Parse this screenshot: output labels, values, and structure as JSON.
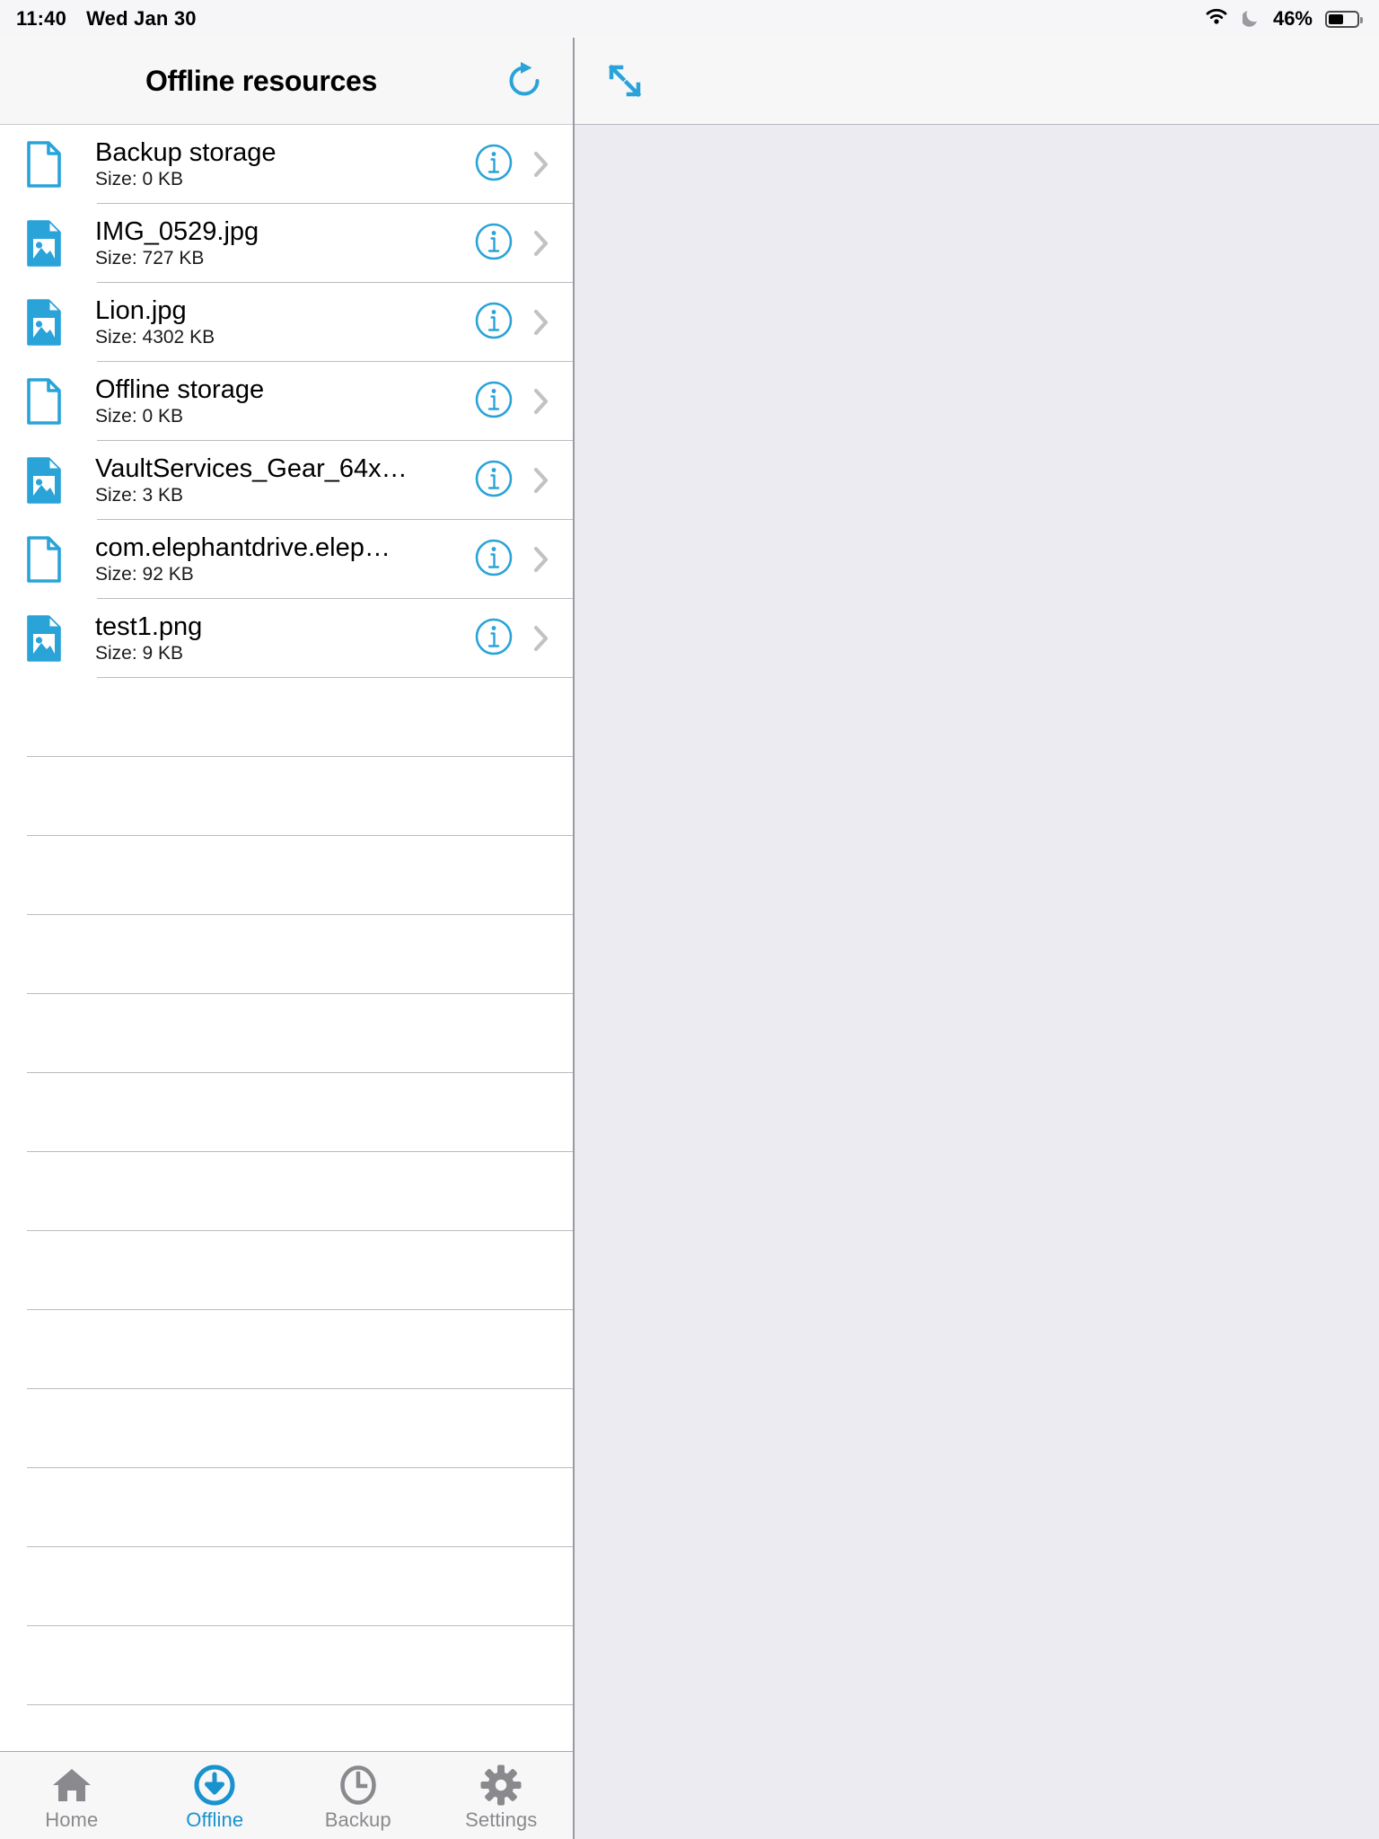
{
  "statusbar": {
    "time": "11:40",
    "date": "Wed Jan 30",
    "battery_percent": "46%",
    "icons": [
      "wifi-icon",
      "moon-icon",
      "battery-icon"
    ]
  },
  "navbar": {
    "title": "Offline resources",
    "refresh_icon": "refresh-icon",
    "expand_icon": "expand-diagonal-icon"
  },
  "colors": {
    "accent": "#1893CE",
    "icon_blue": "#29A3D8",
    "separator": "#BCBCC0",
    "detail_pane_bg": "#ECEBF1",
    "bar_bg": "#F7F7F8",
    "tab_inactive": "#8A8A8E"
  },
  "list": {
    "info_icon": "info-circle-icon",
    "chevron_icon": "chevron-right-icon",
    "empty_row_count": 13,
    "items": [
      {
        "name": "Backup storage",
        "size": "Size: 0 KB",
        "icon": "document-file-icon"
      },
      {
        "name": "IMG_0529.jpg",
        "size": "Size: 727 KB",
        "icon": "image-file-icon"
      },
      {
        "name": "Lion.jpg",
        "size": "Size: 4302 KB",
        "icon": "image-file-icon"
      },
      {
        "name": "Offline storage",
        "size": "Size: 0 KB",
        "icon": "document-file-icon"
      },
      {
        "name": "VaultServices_Gear_64x…",
        "size": "Size: 3 KB",
        "icon": "image-file-icon"
      },
      {
        "name": "com.elephantdrive.elep…",
        "size": "Size: 92 KB",
        "icon": "document-file-icon"
      },
      {
        "name": "test1.png",
        "size": "Size: 9 KB",
        "icon": "image-file-icon"
      }
    ]
  },
  "tabbar": {
    "active_index": 1,
    "tabs": [
      {
        "label": "Home",
        "icon": "home-icon"
      },
      {
        "label": "Offline",
        "icon": "download-circle-icon"
      },
      {
        "label": "Backup",
        "icon": "clock-icon"
      },
      {
        "label": "Settings",
        "icon": "gear-icon"
      }
    ]
  }
}
